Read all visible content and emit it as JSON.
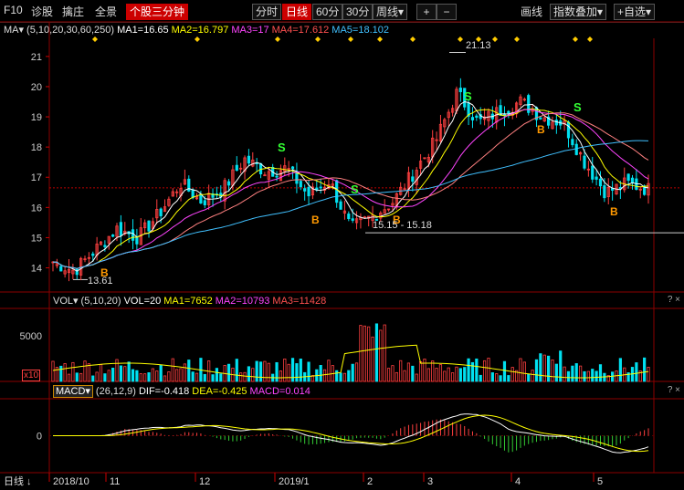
{
  "toolbar": {
    "f10": "F10",
    "diagnose": "诊股",
    "zhuang": "擒庄",
    "quanjing": "全景",
    "three_min": "个股三分钟",
    "periods": [
      "分时",
      "日线",
      "60分",
      "30分",
      "周线"
    ],
    "period_dropdown": "▾",
    "plus": "+",
    "minus": "−",
    "draw_line": "画线",
    "index_overlay": "指数叠加",
    "self_select": "+自选"
  },
  "price_panel": {
    "ma_label": "MA▾",
    "ma_params": "(5,10,20,30,60,250)",
    "ma1": "MA1=16.65",
    "ma2": "MA2=16.797",
    "ma3": "MA3=17",
    "ma4": "MA4=17.612",
    "ma5": "MA5=18.102",
    "high_annot": "21.13",
    "low_annot": "13.61",
    "range_annot": "15.15 - 15.18",
    "y_ticks": [
      "21",
      "20",
      "19",
      "18",
      "17",
      "16",
      "15",
      "14"
    ],
    "signals_b": [
      "B",
      "B",
      "B",
      "B",
      "B",
      "B"
    ],
    "signals_s": [
      "S",
      "S",
      "S",
      "S"
    ]
  },
  "volume_panel": {
    "vol_label": "VOL▾",
    "vol_params": "(5,10,20)",
    "vol20": "VOL=20",
    "ma1": "MA1=7652",
    "ma2": "MA2=10793",
    "ma3": "MA3=11428",
    "y_tick": "5000",
    "unit": "x10",
    "help": "? ×"
  },
  "macd_panel": {
    "macd_label": "MACD▾",
    "macd_params": "(26,12,9)",
    "dif": "DIF=-0.418",
    "dea": "DEA=-0.425",
    "macd": "MACD=0.014",
    "y_tick": "0",
    "help": "? ×"
  },
  "x_axis": {
    "period_label": "日线",
    "labels": [
      "2018/10",
      "11",
      "12",
      "2019/1",
      "2",
      "3",
      "4",
      "5"
    ]
  },
  "colors": {
    "up": "#ff4040",
    "down": "#00e0f0",
    "ma1": "#ffffff",
    "ma2": "#ffff00",
    "ma3": "#ff44ff",
    "ma4": "#00ff00",
    "ma5": "#ff8080",
    "ma6": "#40c0ff",
    "signal_b": "#ff9900",
    "signal_s": "#33ff33"
  },
  "chart_data": {
    "type": "candlestick",
    "price_range": [
      13.2,
      21.6
    ],
    "x_months": [
      "2018/10",
      "11",
      "12",
      "2019/1",
      "2",
      "3",
      "4",
      "5"
    ],
    "high": 21.13,
    "low": 13.61,
    "anchors": [
      {
        "label": "2018/10",
        "close": 14.2
      },
      {
        "label": "11",
        "close": 15.0
      },
      {
        "label": "12",
        "close": 16.8
      },
      {
        "label": "2019/1",
        "close": 17.2
      },
      {
        "label": "2",
        "close": 15.5
      },
      {
        "label": "3",
        "close": 19.5
      },
      {
        "label": "4",
        "close": 19.0
      },
      {
        "label": "5",
        "close": 16.5
      }
    ]
  }
}
